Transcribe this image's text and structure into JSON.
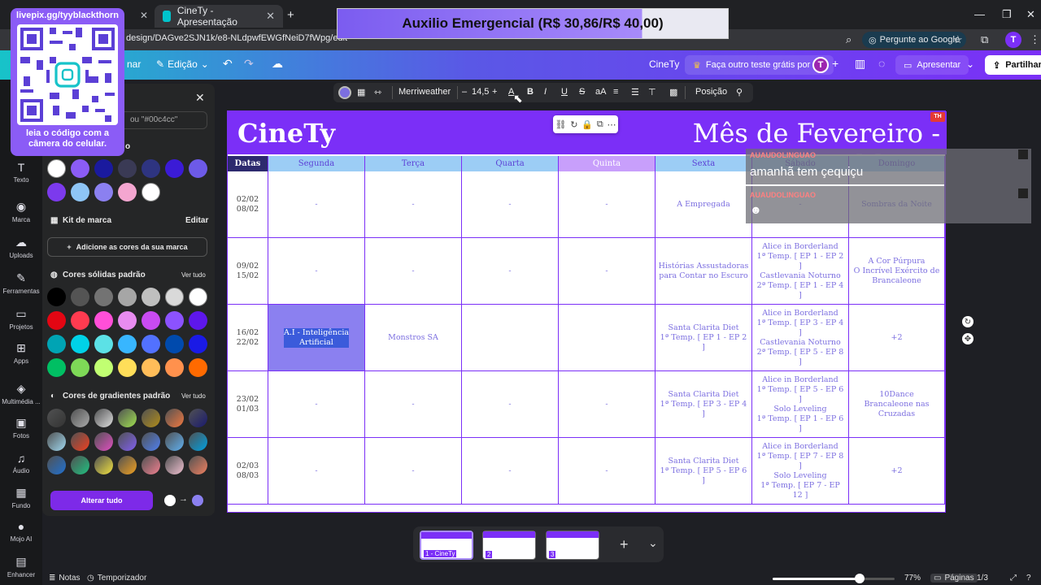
{
  "browser": {
    "tab1_title": "CineTy - Apresentação",
    "new_tab": "+",
    "url": "design/DAGve2SJN1k/e8-NLdpwfEWGfNeiD7fWpg/edit",
    "google_btn": "Pergunte ao Google",
    "avatar_letter": "T",
    "win_min": "—",
    "win_max": "❐",
    "win_close": "✕"
  },
  "overlay": {
    "auxilio": "Auxilio Emergencial (R$ 30,86/R$ 40,00)",
    "auxilio_progress": 0.77,
    "qr_url": "livepix.gg/tyyblackthorn",
    "qr_caption_1": "leia o código com a",
    "qr_caption_2": "câmera do celular."
  },
  "header": {
    "menu_partial": "nar",
    "edicao": "Edição",
    "doc_name": "CineTy",
    "trial": "Faça outro teste grátis por 0 $",
    "avatar": "T",
    "apresentar": "Apresentar",
    "partilhar": "Partilhar"
  },
  "rail": [
    {
      "label": "Texto",
      "icon": "T"
    },
    {
      "label": "Marca",
      "icon": "◉"
    },
    {
      "label": "Uploads",
      "icon": "☁"
    },
    {
      "label": "Ferramentas",
      "icon": "✎"
    },
    {
      "label": "Projetos",
      "icon": "▭"
    },
    {
      "label": "Apps",
      "icon": "⊞"
    },
    {
      "label": "Multimédia ...",
      "icon": "◈"
    },
    {
      "label": "Fotos",
      "icon": "▣"
    },
    {
      "label": "Áudio",
      "icon": "♫"
    },
    {
      "label": "Fundo",
      "icon": "▦"
    },
    {
      "label": "Mojo AI",
      "icon": "●"
    },
    {
      "label": "Enhancer",
      "icon": "▤"
    }
  ],
  "panel": {
    "search_placeholder": "ou \"#00c4cc\"",
    "partial_title": "o",
    "kit": "Kit de marca",
    "editar": "Editar",
    "add_brand": "Adicione as cores da sua marca",
    "solid": "Cores sólidas padrão",
    "gradients": "Cores de gradientes padrão",
    "ver_tudo": "Ver tudo",
    "alterar": "Alterar tudo",
    "doc_colors": [
      "#ffffff",
      "#8b5cf6",
      "#1a1a9e",
      "#3a3a55",
      "#2e3480",
      "#3b1bd6",
      "#6d5ae8",
      "#7c3aed",
      "#8ec5f5",
      "#8b80f0",
      "#f4a6d0",
      "#ffffff"
    ],
    "solid_colors": [
      "#000000",
      "#545454",
      "#737373",
      "#a6a6a6",
      "#bfbfbf",
      "#d9d9d9",
      "#ffffff",
      "#e30613",
      "#ff3b50",
      "#ff4fd8",
      "#e88cf0",
      "#c94bf2",
      "#8c52ff",
      "#5e17eb",
      "#00a4b4",
      "#00d2e8",
      "#5ce1e6",
      "#38b6ff",
      "#5271ff",
      "#004aad",
      "#1a1ae6",
      "#00bf63",
      "#7ed957",
      "#c1ff72",
      "#ffde59",
      "#ffbd59",
      "#ff914d",
      "#ff6a00"
    ],
    "gradient_colors": [
      "#333333",
      "#aaaaaa",
      "#dddddd",
      "#a0e050",
      "#b08c1a",
      "#f07840",
      "#1a1a6e",
      "#a0d8f0",
      "#f04020",
      "#e050c0",
      "#8060f0",
      "#5080f0",
      "#60b0f0",
      "#00a0e0",
      "#2070d0",
      "#20c080",
      "#f0e040",
      "#f0a020",
      "#f08090",
      "#f0c0d0",
      "#f08060"
    ]
  },
  "toolbar": {
    "font": "Merriweather",
    "size": "14,5",
    "minus": "–",
    "plus": "+",
    "posicao": "Posição"
  },
  "design": {
    "title_left": "CineTy",
    "title_right": "Mês de Fevereiro - Março",
    "badge": "TH",
    "headers": [
      "Datas",
      "Segunda",
      "Terça",
      "Quarta",
      "Quinta",
      "Sexta",
      "Sábado",
      "Domingo"
    ],
    "rows": [
      [
        "02/02\n08/02",
        "-",
        "-",
        "-",
        "-",
        "A Empregada",
        "-",
        "Sombras da Noite"
      ],
      [
        "09/02\n15/02",
        "-",
        "-",
        "-",
        "-",
        "Histórias Assustadoras\npara Contar no Escuro",
        "Alice in Borderland\n1ª Temp. [ EP 1 - EP 2 ]\nCastlevania Noturno\n2ª Temp. [ EP 1 - EP 4 ]",
        "A Cor Púrpura\nO Incrível Exército de\nBrancaleone"
      ],
      [
        "16/02\n22/02",
        "A.I - Inteligência\nArtificial",
        "Monstros SA",
        "",
        "",
        "Santa Clarita Diet\n1ª Temp. [ EP 1 - EP 2 ]",
        "Alice in Borderland\n1ª Temp. [ EP 3 - EP 4 ]\nCastlevania Noturno\n2ª Temp. [ EP 5 - EP 8 ]",
        "+2"
      ],
      [
        "23/02\n01/03",
        "-",
        "-",
        "-",
        "-",
        "Santa Clarita Diet\n1ª Temp. [ EP 3 - EP 4 ]",
        "Alice in Borderland\n1ª Temp. [ EP 5 - EP 6 ]\nSolo Leveling\n1ª Temp. [ EP 1 - EP 6 ]",
        "10Dance\nBrancaleone nas\nCruzadas"
      ],
      [
        "02/03\n08/03",
        "-",
        "-",
        "-",
        "-",
        "Santa Clarita Diet\n1ª Temp. [ EP 5 - EP 6 ]",
        "Alice in Borderland\n1ª Temp. [ EP 7 - EP 8 ]\nSolo Leveling\n1ª Temp. [ EP 7 - EP 12 ]",
        "+2"
      ]
    ]
  },
  "chat": {
    "user1": "AUAUDOLINGUAO",
    "msg1": "amanhã tem çequiçu",
    "user2": "AUAUDOLINGUAO"
  },
  "footer": {
    "notas": "Notas",
    "temporizador": "Temporizador",
    "zoom": "77%",
    "zoom_level": 0.71,
    "paginas": "Páginas",
    "page_count": "1/3",
    "thumb1": "1 - CineTy",
    "thumb2": "2",
    "thumb3": "3",
    "add_page": "+",
    "chevron": "⌄"
  }
}
